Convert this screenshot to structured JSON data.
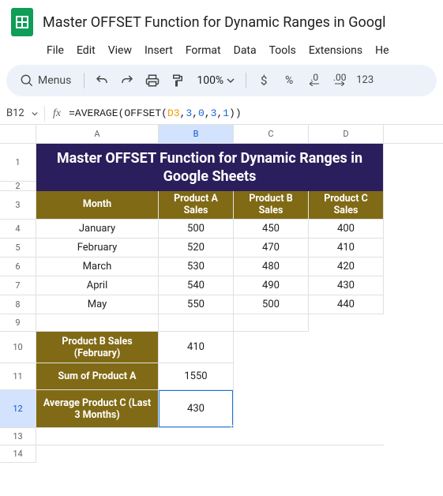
{
  "doc": {
    "title": "Master OFFSET Function for Dynamic Ranges in Googl"
  },
  "menu": {
    "file": "File",
    "edit": "Edit",
    "view": "View",
    "insert": "Insert",
    "format": "Format",
    "data": "Data",
    "tools": "Tools",
    "extensions": "Extensions",
    "help": "He"
  },
  "toolbar": {
    "menus": "Menus",
    "zoom": "100%",
    "currency": "$",
    "percent": "%",
    "decdec": ".0",
    "decinc": ".00",
    "num": "123"
  },
  "namebox": "B12",
  "formula": {
    "raw": "=AVERAGE(OFFSET(D3,3,0,3,1))",
    "p1": "=AVERAGE(OFFSET(",
    "ref": "D3",
    "p2": ",",
    "n1": "3",
    "n2": "0",
    "n3": "3",
    "n4": "1",
    "p3": "))"
  },
  "cols": {
    "A": "A",
    "B": "B",
    "C": "C",
    "D": "D"
  },
  "rows": {
    "r1": "1",
    "r2": "2",
    "r3": "3",
    "r4": "4",
    "r5": "5",
    "r6": "6",
    "r7": "7",
    "r8": "8",
    "r9": "9",
    "r10": "10",
    "r11": "11",
    "r12": "12",
    "r13": "13",
    "r14": "14"
  },
  "banner": "Master OFFSET Function for Dynamic Ranges in Google Sheets",
  "headers": {
    "month": "Month",
    "pa": "Product A Sales",
    "pb": "Product B Sales",
    "pc": "Product C Sales"
  },
  "data": {
    "r4": {
      "m": "January",
      "a": "500",
      "b": "450",
      "c": "400"
    },
    "r5": {
      "m": "February",
      "a": "520",
      "b": "470",
      "c": "410"
    },
    "r6": {
      "m": "March",
      "a": "530",
      "b": "480",
      "c": "420"
    },
    "r7": {
      "m": "April",
      "a": "540",
      "b": "490",
      "c": "430"
    },
    "r8": {
      "m": "May",
      "a": "550",
      "b": "500",
      "c": "440"
    }
  },
  "summary": {
    "r10": {
      "label": "Product B Sales (February)",
      "val": "410"
    },
    "r11": {
      "label": "Sum of Product A",
      "val": "1550"
    },
    "r12": {
      "label": "Average Product C (Last 3 Months)",
      "val": "430"
    }
  }
}
